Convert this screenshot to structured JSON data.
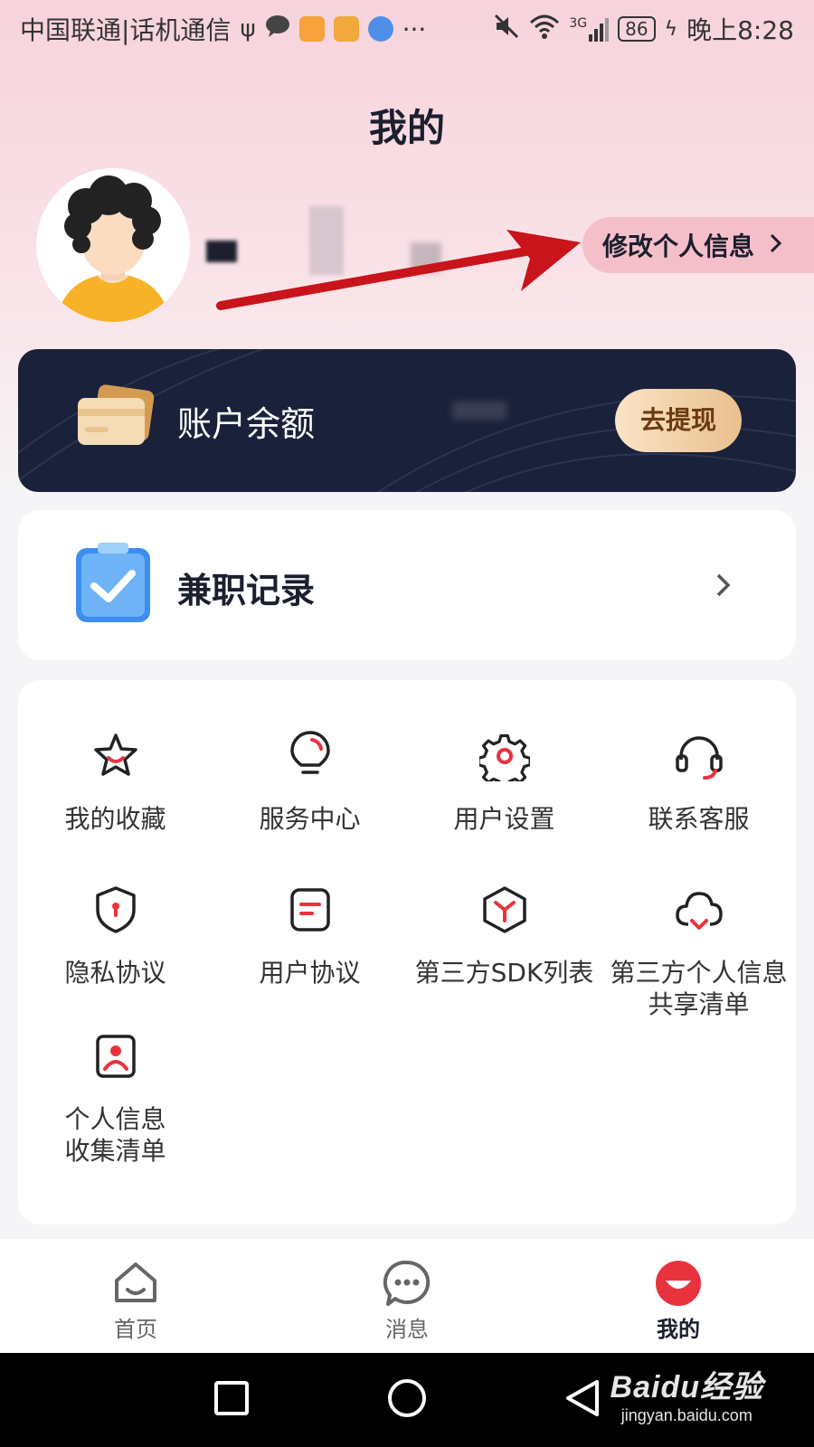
{
  "status_bar": {
    "carrier": "中国联通|话机通信",
    "network": "3G",
    "battery": "86",
    "time": "晚上8:28",
    "more": "···"
  },
  "page": {
    "title": "我的"
  },
  "profile": {
    "edit_label": "修改个人信息"
  },
  "balance": {
    "label": "账户余额",
    "withdraw_label": "去提现"
  },
  "record": {
    "label": "兼职记录"
  },
  "menu": {
    "items": [
      {
        "label": "我的收藏",
        "icon": "star-icon"
      },
      {
        "label": "服务中心",
        "icon": "lightbulb-icon"
      },
      {
        "label": "用户设置",
        "icon": "gear-icon"
      },
      {
        "label": "联系客服",
        "icon": "headset-icon"
      },
      {
        "label": "隐私协议",
        "icon": "shield-icon"
      },
      {
        "label": "用户协议",
        "icon": "document-icon"
      },
      {
        "label": "第三方SDK列表",
        "icon": "cube-icon"
      },
      {
        "label_line1": "第三方个人信息",
        "label_line2": "共享清单",
        "icon": "cloud-icon"
      },
      {
        "label_line1": "个人信息",
        "label_line2": "收集清单",
        "icon": "person-card-icon"
      }
    ]
  },
  "tabs": [
    {
      "label": "首页",
      "icon": "home-icon"
    },
    {
      "label": "消息",
      "icon": "message-icon"
    },
    {
      "label": "我的",
      "icon": "me-icon",
      "active": true
    }
  ],
  "colors": {
    "accent": "#e8333f",
    "dark_card": "#1a213a",
    "pink_header": "#f7d3dc",
    "annotation_arrow": "#c8141a"
  },
  "watermark": {
    "logo": "Baidu经验",
    "url": "jingyan.baidu.com"
  }
}
